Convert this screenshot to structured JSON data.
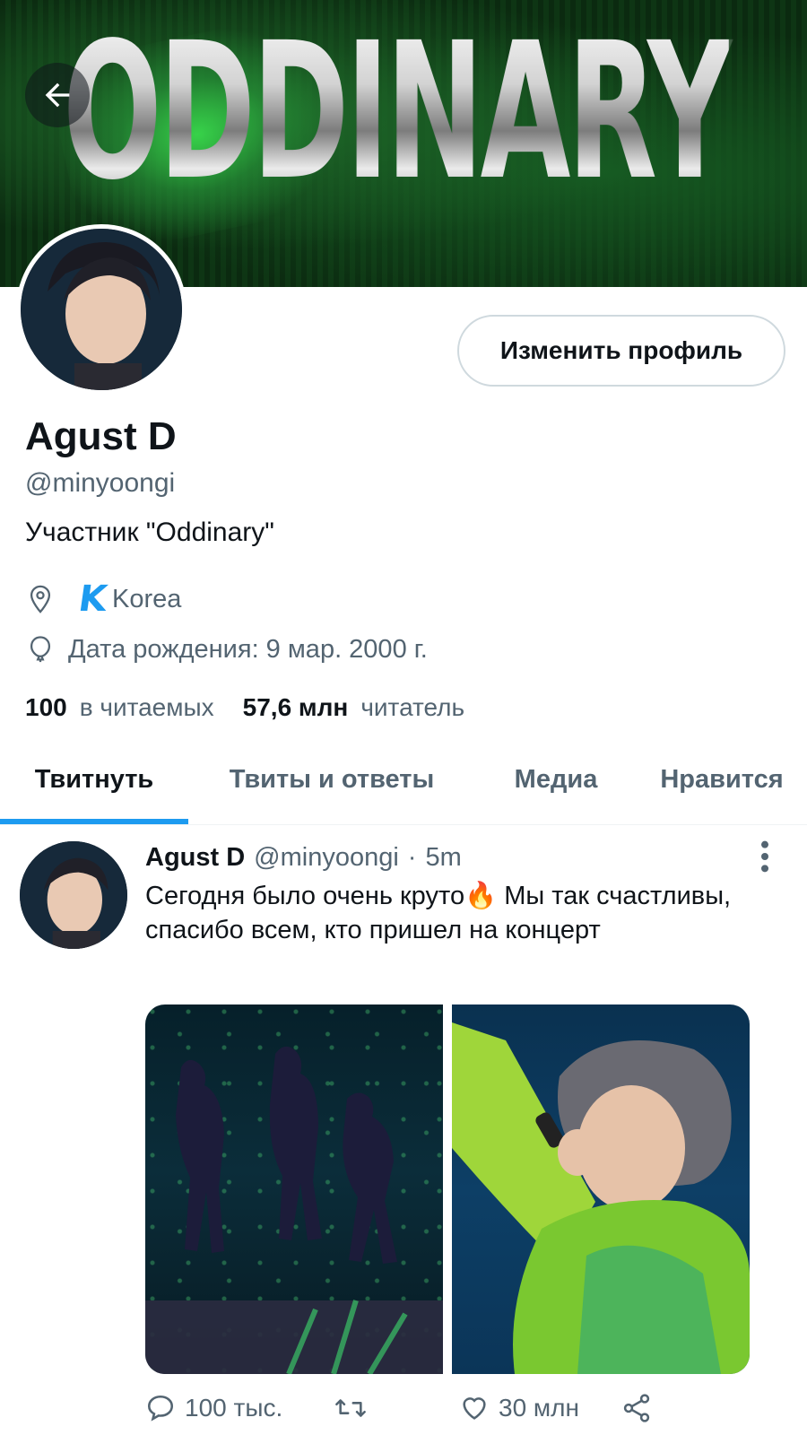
{
  "banner": {
    "title": "ODDINARY"
  },
  "profile": {
    "edit_label": "Изменить профиль",
    "name": "Agust D",
    "handle": "@minyoongi",
    "bio": "Участник \"Oddinary\"",
    "location_icon_text": "K",
    "location": "Korea",
    "birthday": "Дата рождения: 9 мар. 2000 г.",
    "following_count": "100",
    "following_label": "в читаемых",
    "followers_count": "57,6 млн",
    "followers_label": "читатель"
  },
  "tabs": [
    {
      "label": "Твитнуть",
      "active": true
    },
    {
      "label": "Твиты и ответы",
      "active": false
    },
    {
      "label": "Медиа",
      "active": false
    },
    {
      "label": "Нравится",
      "active": false
    }
  ],
  "tweet": {
    "name": "Agust D",
    "handle": "@minyoongi",
    "dot": "·",
    "time": "5m",
    "text": "Сегодня было очень круто🔥 Мы так счастливы, спасибо всем, кто пришел на концерт",
    "replies": "100 тыс.",
    "retweets": "",
    "likes": "30 млн"
  },
  "colors": {
    "accent": "#1d9bf0",
    "text": "#0f1419",
    "muted": "#536471"
  },
  "icons": [
    "back-arrow-icon",
    "location-pin-icon",
    "balloon-icon",
    "more-vertical-icon",
    "reply-icon",
    "retweet-icon",
    "like-icon",
    "share-icon"
  ]
}
